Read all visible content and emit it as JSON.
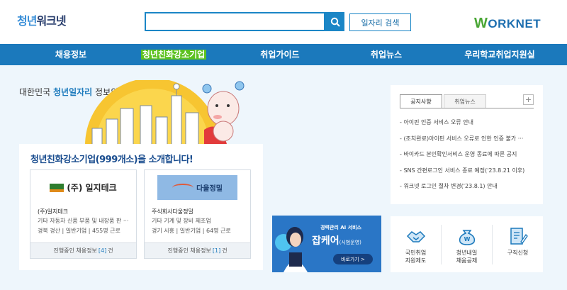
{
  "header": {
    "logo_part1": "청년",
    "logo_part2": "워크넷",
    "search_placeholder": "",
    "search_button_label": "일자리 검색",
    "worknet_w": "W",
    "worknet_rest": "ORKNET"
  },
  "nav": {
    "items": [
      {
        "label": "채용정보"
      },
      {
        "label": "청년친화강소기업"
      },
      {
        "label": "취업가이드"
      },
      {
        "label": "취업뉴스"
      },
      {
        "label": "우리학교취업지원실"
      }
    ]
  },
  "hero": {
    "text_prefix": "대한민국",
    "text_highlight": "청년일자리",
    "text_suffix": "정보의 모든것!"
  },
  "intro": {
    "title": "청년친화강소기업(999개소)을 소개합니다!",
    "cards": [
      {
        "logo_text": "(주) 일지테크",
        "name": "(주)일지테크",
        "desc": "기타 자동차 신품 부품 및 내장품 판 ···",
        "meta": "경북 경산 | 일반기업 | 455명 근로",
        "footer_prefix": "진행중인 채용정보",
        "footer_count": "[4]",
        "footer_suffix": "건"
      },
      {
        "logo_text": "다울정밀",
        "name": "주식회사다울정밀",
        "desc": "기타 기계 및 장비 제조업",
        "meta": "경기 시흥 | 일반기업 | 64명 근로",
        "footer_prefix": "진행중인 채용정보",
        "footer_count": "[1]",
        "footer_suffix": "건"
      }
    ]
  },
  "banner": {
    "subtitle": "경력관리 AI 서비스",
    "title": "잡케어",
    "title_note": "(시범운영)",
    "button": "바로가기 >"
  },
  "notice": {
    "tabs": [
      {
        "label": "공지사항"
      },
      {
        "label": "취업뉴스"
      }
    ],
    "more": "+",
    "items": [
      "아이핀 인증 서비스 오류 안내",
      "(조치완료)아이핀 서비스 오류로 인한 인증 불가 ···",
      "바이카드 본인확인서비스 운영 종료에 따른 공지",
      "SNS 간편로그인 서비스 종료 예정('23.8.21 이후)",
      "워크넷 로그인 절차 변경('23.8.1) 안내"
    ]
  },
  "quick": {
    "items": [
      {
        "label": "국민취업\n지원제도",
        "icon": "handshake-icon"
      },
      {
        "label": "청년내일\n채움공제",
        "icon": "money-pouch-icon"
      },
      {
        "label": "구직신청",
        "icon": "document-pen-icon"
      }
    ]
  },
  "colors": {
    "nav": "#1b79bc",
    "accent_green": "#5cc21f",
    "background": "#eef6fc"
  }
}
